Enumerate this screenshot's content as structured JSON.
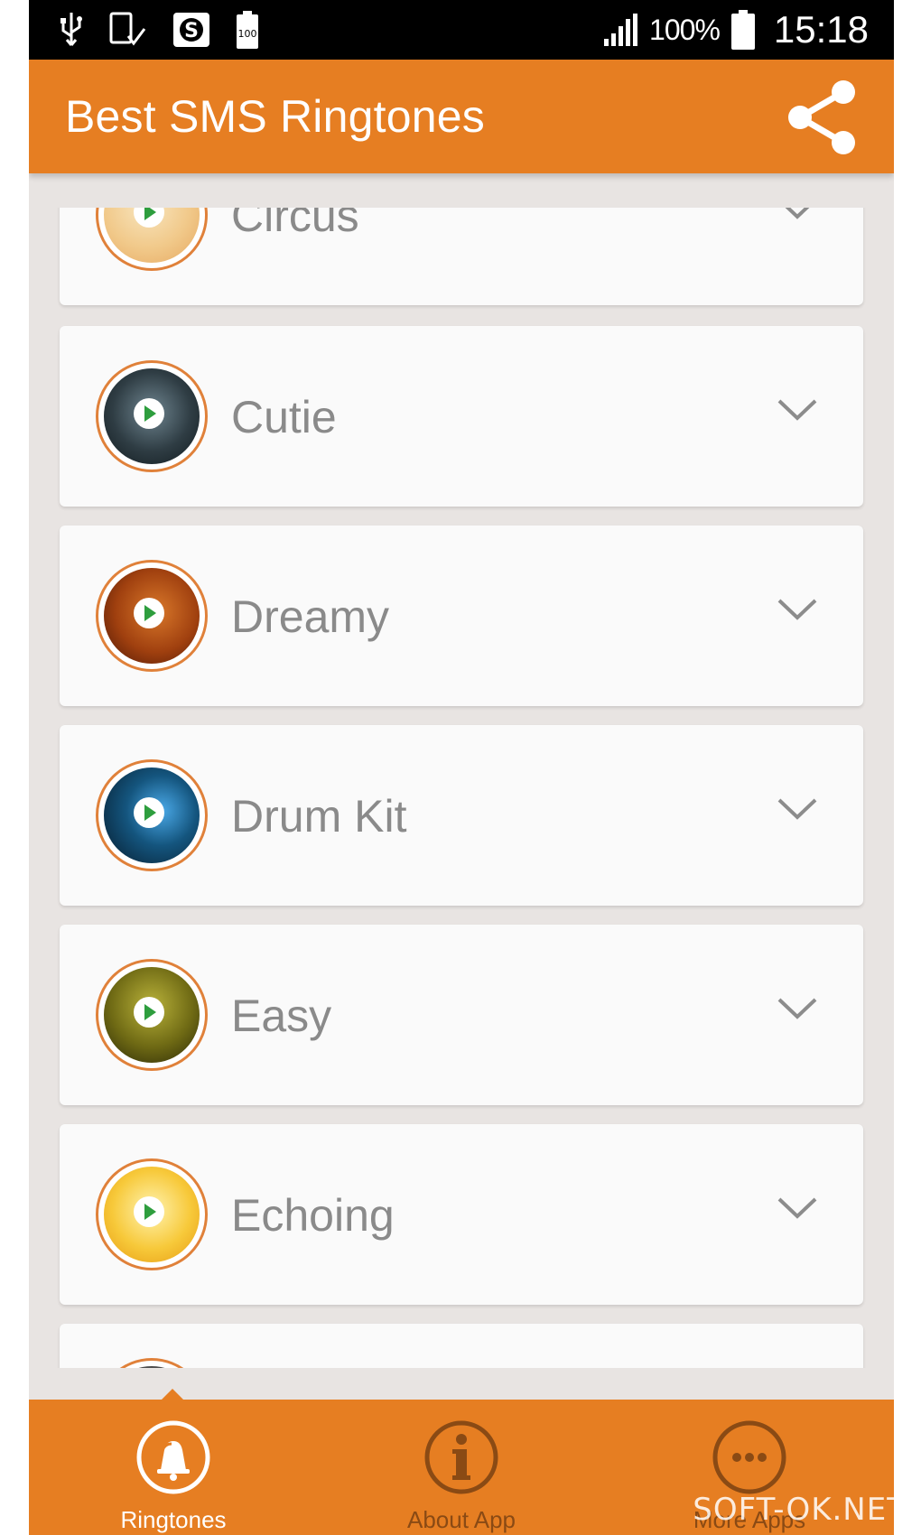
{
  "status_bar": {
    "battery_percent": "100%",
    "time": "15:18",
    "battery_icon_text": "100",
    "icons": [
      "usb-icon",
      "screenshot-icon",
      "s-app-icon",
      "battery-small-icon",
      "signal-icon",
      "battery-icon"
    ]
  },
  "toolbar": {
    "title": "Best SMS Ringtones",
    "share_icon": "share-icon"
  },
  "ringtones": [
    {
      "name": "Circus",
      "art": "circus"
    },
    {
      "name": "Cutie",
      "art": "cutie"
    },
    {
      "name": "Dreamy",
      "art": "dreamy"
    },
    {
      "name": "Drum Kit",
      "art": "drumkit"
    },
    {
      "name": "Easy",
      "art": "easy"
    },
    {
      "name": "Echoing",
      "art": "echoing"
    },
    {
      "name": "",
      "art": "next"
    }
  ],
  "bottom_nav": {
    "items": [
      {
        "label": "Ringtones",
        "icon": "bell-icon",
        "active": true
      },
      {
        "label": "About App",
        "icon": "info-icon",
        "active": false
      },
      {
        "label": "More Apps",
        "icon": "more-icon",
        "active": false
      }
    ]
  },
  "watermark": "SOFT-OK.NET",
  "colors": {
    "accent": "#e67e22",
    "background": "#e8e4e2",
    "card": "#fafafa",
    "play": "#2e9e3e",
    "text": "#8a8a8a"
  }
}
